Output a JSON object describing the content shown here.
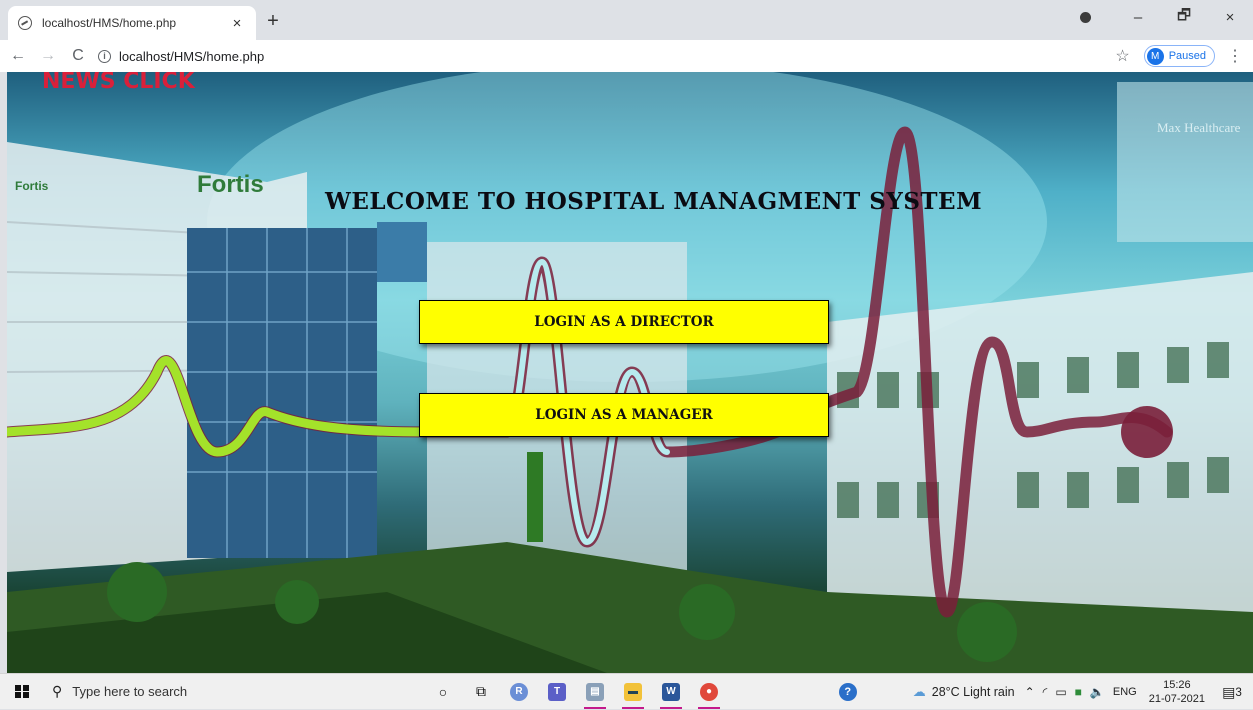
{
  "browser": {
    "tab_title": "localhost/HMS/home.php",
    "tab_close": "×",
    "new_tab": "+",
    "url": "localhost/HMS/home.php",
    "profile_initial": "M",
    "profile_status": "Paused",
    "window_controls": {
      "minimize": "–",
      "restore": "🗗",
      "close": "×"
    }
  },
  "page": {
    "watermark": "NEWS CLICK",
    "title": "WELCOME TO HOSPITAL MANAGMENT SYSTEM",
    "buttons": {
      "director": "LOGIN AS A DIRECTOR",
      "manager": "LOGIN AS A MANAGER"
    },
    "background_signage": [
      "Fortis",
      "Fortis",
      "Max Healthcare"
    ]
  },
  "taskbar": {
    "search_placeholder": "Type here to search",
    "pinned_icons": [
      "cortana-icon",
      "task-view-icon",
      "r-app-icon",
      "teams-icon",
      "app-window-icon",
      "file-explorer-icon",
      "word-icon",
      "chrome-icon"
    ],
    "weather": "28°C  Light rain",
    "language": "ENG",
    "time": "15:26",
    "date": "21-07-2021",
    "notification_count": "3"
  },
  "colors": {
    "button_bg": "#ffff00",
    "title_text": "#0b0b12",
    "accent_blue": "#1a73e8"
  }
}
